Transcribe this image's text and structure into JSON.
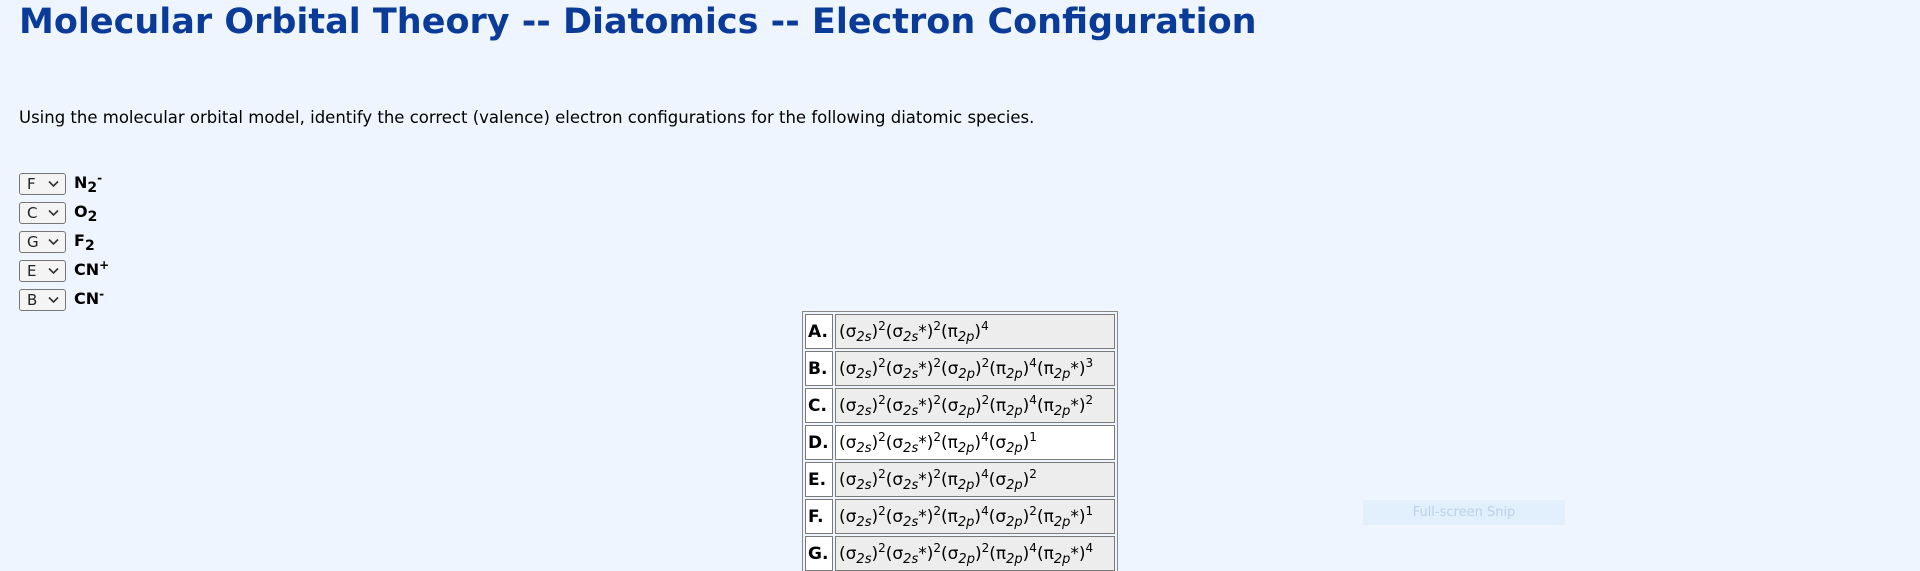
{
  "title": "Molecular Orbital Theory -- Diatomics -- Electron Configuration",
  "instructions": "Using the molecular orbital model, identify the correct (valence) electron configurations for the following diatomic species.",
  "questions": [
    {
      "selected": "F",
      "species": "N",
      "subscript": "2",
      "superscript": "-"
    },
    {
      "selected": "C",
      "species": "O",
      "subscript": "2",
      "superscript": ""
    },
    {
      "selected": "G",
      "species": "F",
      "subscript": "2",
      "superscript": ""
    },
    {
      "selected": "E",
      "species": "CN",
      "subscript": "",
      "superscript": "+"
    },
    {
      "selected": "B",
      "species": "CN",
      "subscript": "",
      "superscript": "-"
    }
  ],
  "answers": [
    {
      "letter": "A.",
      "terms": [
        [
          "σ",
          "2s",
          "",
          "2"
        ],
        [
          "σ",
          "2s",
          "*",
          "2"
        ],
        [
          "π",
          "2p",
          "",
          "4"
        ]
      ]
    },
    {
      "letter": "B.",
      "terms": [
        [
          "σ",
          "2s",
          "",
          "2"
        ],
        [
          "σ",
          "2s",
          "*",
          "2"
        ],
        [
          "σ",
          "2p",
          "",
          "2"
        ],
        [
          "π",
          "2p",
          "",
          "4"
        ],
        [
          "π",
          "2p",
          "*",
          "3"
        ]
      ]
    },
    {
      "letter": "C.",
      "terms": [
        [
          "σ",
          "2s",
          "",
          "2"
        ],
        [
          "σ",
          "2s",
          "*",
          "2"
        ],
        [
          "σ",
          "2p",
          "",
          "2"
        ],
        [
          "π",
          "2p",
          "",
          "4"
        ],
        [
          "π",
          "2p",
          "*",
          "2"
        ]
      ]
    },
    {
      "letter": "D.",
      "terms": [
        [
          "σ",
          "2s",
          "",
          "2"
        ],
        [
          "σ",
          "2s",
          "*",
          "2"
        ],
        [
          "π",
          "2p",
          "",
          "4"
        ],
        [
          "σ",
          "2p",
          "",
          "1"
        ]
      ]
    },
    {
      "letter": "E.",
      "terms": [
        [
          "σ",
          "2s",
          "",
          "2"
        ],
        [
          "σ",
          "2s",
          "*",
          "2"
        ],
        [
          "π",
          "2p",
          "",
          "4"
        ],
        [
          "σ",
          "2p",
          "",
          "2"
        ]
      ]
    },
    {
      "letter": "F.",
      "terms": [
        [
          "σ",
          "2s",
          "",
          "2"
        ],
        [
          "σ",
          "2s",
          "*",
          "2"
        ],
        [
          "π",
          "2p",
          "",
          "4"
        ],
        [
          "σ",
          "2p",
          "",
          "2"
        ],
        [
          "π",
          "2p",
          "*",
          "1"
        ]
      ]
    },
    {
      "letter": "G.",
      "terms": [
        [
          "σ",
          "2s",
          "",
          "2"
        ],
        [
          "σ",
          "2s",
          "*",
          "2"
        ],
        [
          "σ",
          "2p",
          "",
          "2"
        ],
        [
          "π",
          "2p",
          "",
          "4"
        ],
        [
          "π",
          "2p",
          "*",
          "4"
        ]
      ]
    }
  ],
  "overlay": {
    "label": "Full-screen Snip"
  },
  "icons": {
    "select_arrow": "chevron-down-icon"
  }
}
